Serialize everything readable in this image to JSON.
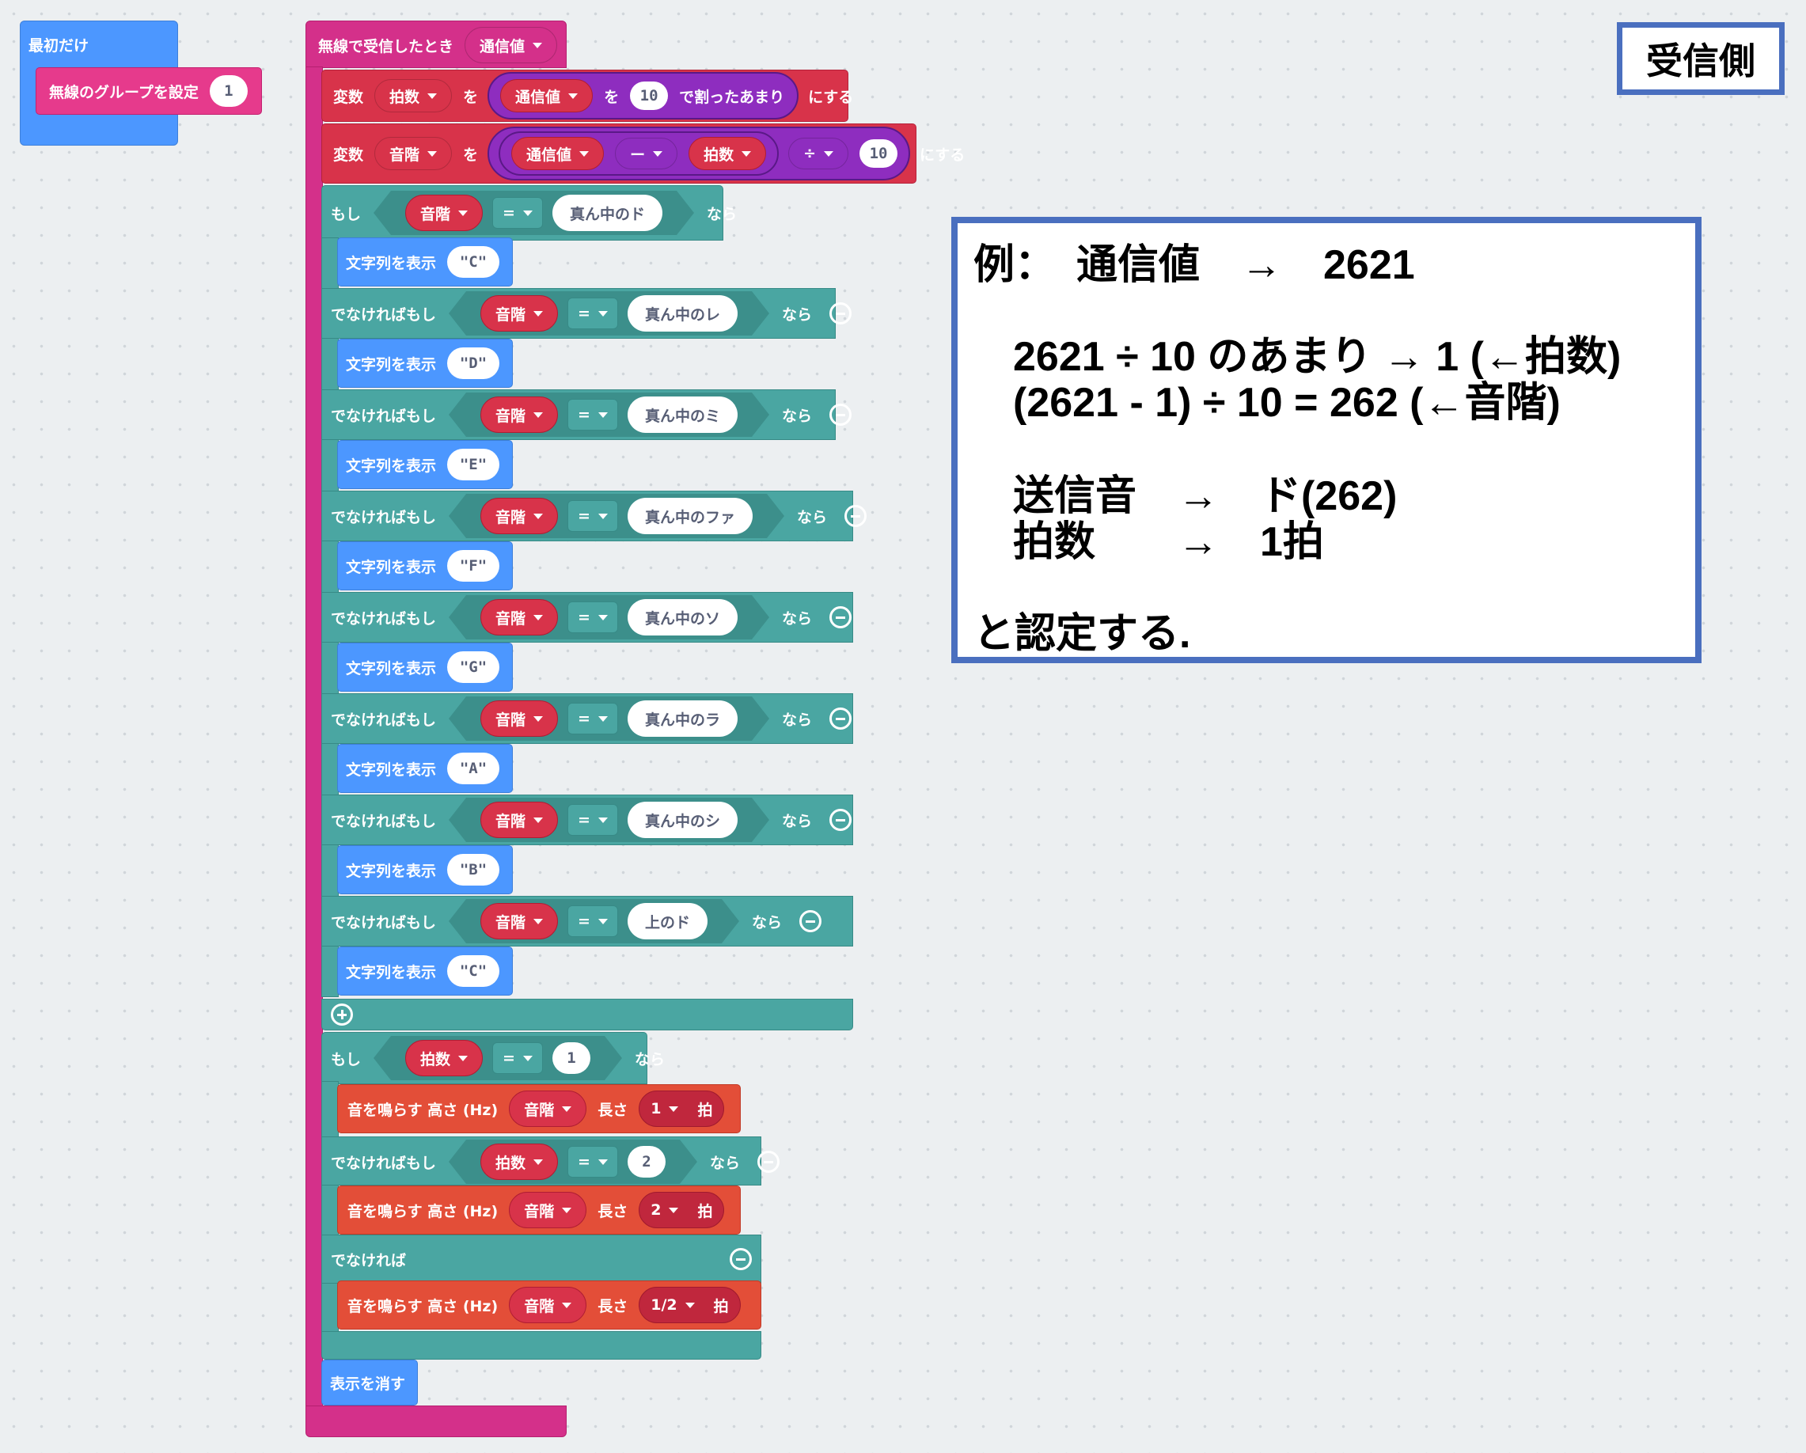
{
  "title_label": "受信側",
  "start_block": {
    "header": "最初だけ",
    "set_group_label": "無線のグループを設定",
    "group_value": "1"
  },
  "radio_block": {
    "header": "無線で受信したとき",
    "param": "通信値"
  },
  "var_beat": {
    "kw_var": "変数",
    "var_name": "拍数",
    "kw_to": "を",
    "src": "通信値",
    "kw_wo": "を",
    "divisor": "10",
    "op_label": "で割ったあまり",
    "kw_set": "にする"
  },
  "var_pitch": {
    "kw_var": "変数",
    "var_name": "音階",
    "kw_to": "を",
    "src": "通信値",
    "op_minus": "ー",
    "sub": "拍数",
    "op_div": "÷",
    "divisor": "10",
    "kw_set": "にする"
  },
  "note_chain": {
    "kw_if": "もし",
    "kw_elseif": "でなければもし",
    "kw_then": "なら",
    "var": "音階",
    "eq": "=",
    "show_label": "文字列を表示",
    "branches": [
      {
        "note": "真ん中のド",
        "text": "\"C\""
      },
      {
        "note": "真ん中のレ",
        "text": "\"D\""
      },
      {
        "note": "真ん中のミ",
        "text": "\"E\""
      },
      {
        "note": "真ん中のファ",
        "text": "\"F\""
      },
      {
        "note": "真ん中のソ",
        "text": "\"G\""
      },
      {
        "note": "真ん中のラ",
        "text": "\"A\""
      },
      {
        "note": "真ん中のシ",
        "text": "\"B\""
      },
      {
        "note": "上のド",
        "text": "\"C\""
      }
    ]
  },
  "beat_chain": {
    "kw_if": "もし",
    "kw_elseif": "でなければもし",
    "kw_else": "でなければ",
    "kw_then": "なら",
    "var": "拍数",
    "eq": "=",
    "play_label": "音を鳴らす 高さ (Hz)",
    "pitch_var": "音階",
    "length_label": "長さ",
    "beat_unit": "拍",
    "conditions": [
      "1",
      "2"
    ],
    "lengths": [
      "1",
      "2",
      "1/2"
    ]
  },
  "clear_label": "表示を消す",
  "explanation": {
    "line1": "例：　通信値　→　2621",
    "line2": "2621 ÷ 10 のあまり → 1 (←拍数)",
    "line3": "(2621 - 1) ÷ 10 = 262 (←音階)",
    "line4": "送信音　→　ド(262)",
    "line5": "拍数　　→　1拍",
    "line6": "と認定する."
  },
  "colors": {
    "background": "#eceff1",
    "basic_blue": "#4c97ff",
    "radio_pink": "#e63a8c",
    "variables_red": "#d8334a",
    "logic_teal": "#4aa6a2",
    "math_purple": "#8e2dbf",
    "music_orange": "#e34e38",
    "box_border": "#4a6fbf"
  }
}
